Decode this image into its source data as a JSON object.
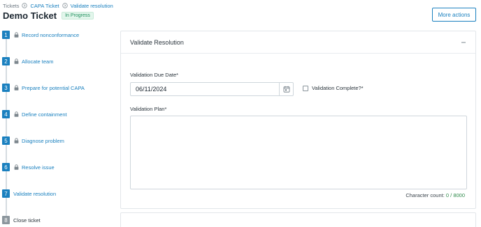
{
  "breadcrumb": {
    "items": [
      "Tickets",
      "CAPA Ticket",
      "Validate resolution"
    ]
  },
  "header": {
    "title": "Demo Ticket",
    "status": "In Progress",
    "more_actions_label": "More actions"
  },
  "steps": [
    {
      "number": "1",
      "label": "Record nonconformance",
      "locked": true,
      "active": true
    },
    {
      "number": "2",
      "label": "Allocate team",
      "locked": true,
      "active": true
    },
    {
      "number": "3",
      "label": "Prepare for potential CAPA",
      "locked": true,
      "active": true
    },
    {
      "number": "4",
      "label": "Define containment",
      "locked": true,
      "active": true
    },
    {
      "number": "5",
      "label": "Diagnose problem",
      "locked": true,
      "active": true
    },
    {
      "number": "6",
      "label": "Resolve issue",
      "locked": true,
      "active": true
    },
    {
      "number": "7",
      "label": "Validate resolution",
      "locked": false,
      "active": true
    },
    {
      "number": "8",
      "label": "Close ticket",
      "locked": false,
      "active": false
    }
  ],
  "panel": {
    "title": "Validate Resolution",
    "due_date_label": "Validation Due Date*",
    "due_date_value": "06/11/2024",
    "complete_label": "Validation Complete?*",
    "plan_label": "Validation Plan*",
    "char_count_prefix": "Character count:",
    "char_count_value": "0 / 8000"
  },
  "colors": {
    "accent": "#1a80bf",
    "success": "#1f8f5c",
    "inactive_step": "#8c969d"
  },
  "icons": {
    "breadcrumb_separator": "chevron-circle-right-icon",
    "step_lock": "lock-icon",
    "panel_collapse": "minus-icon",
    "date_picker": "calendar-icon"
  }
}
